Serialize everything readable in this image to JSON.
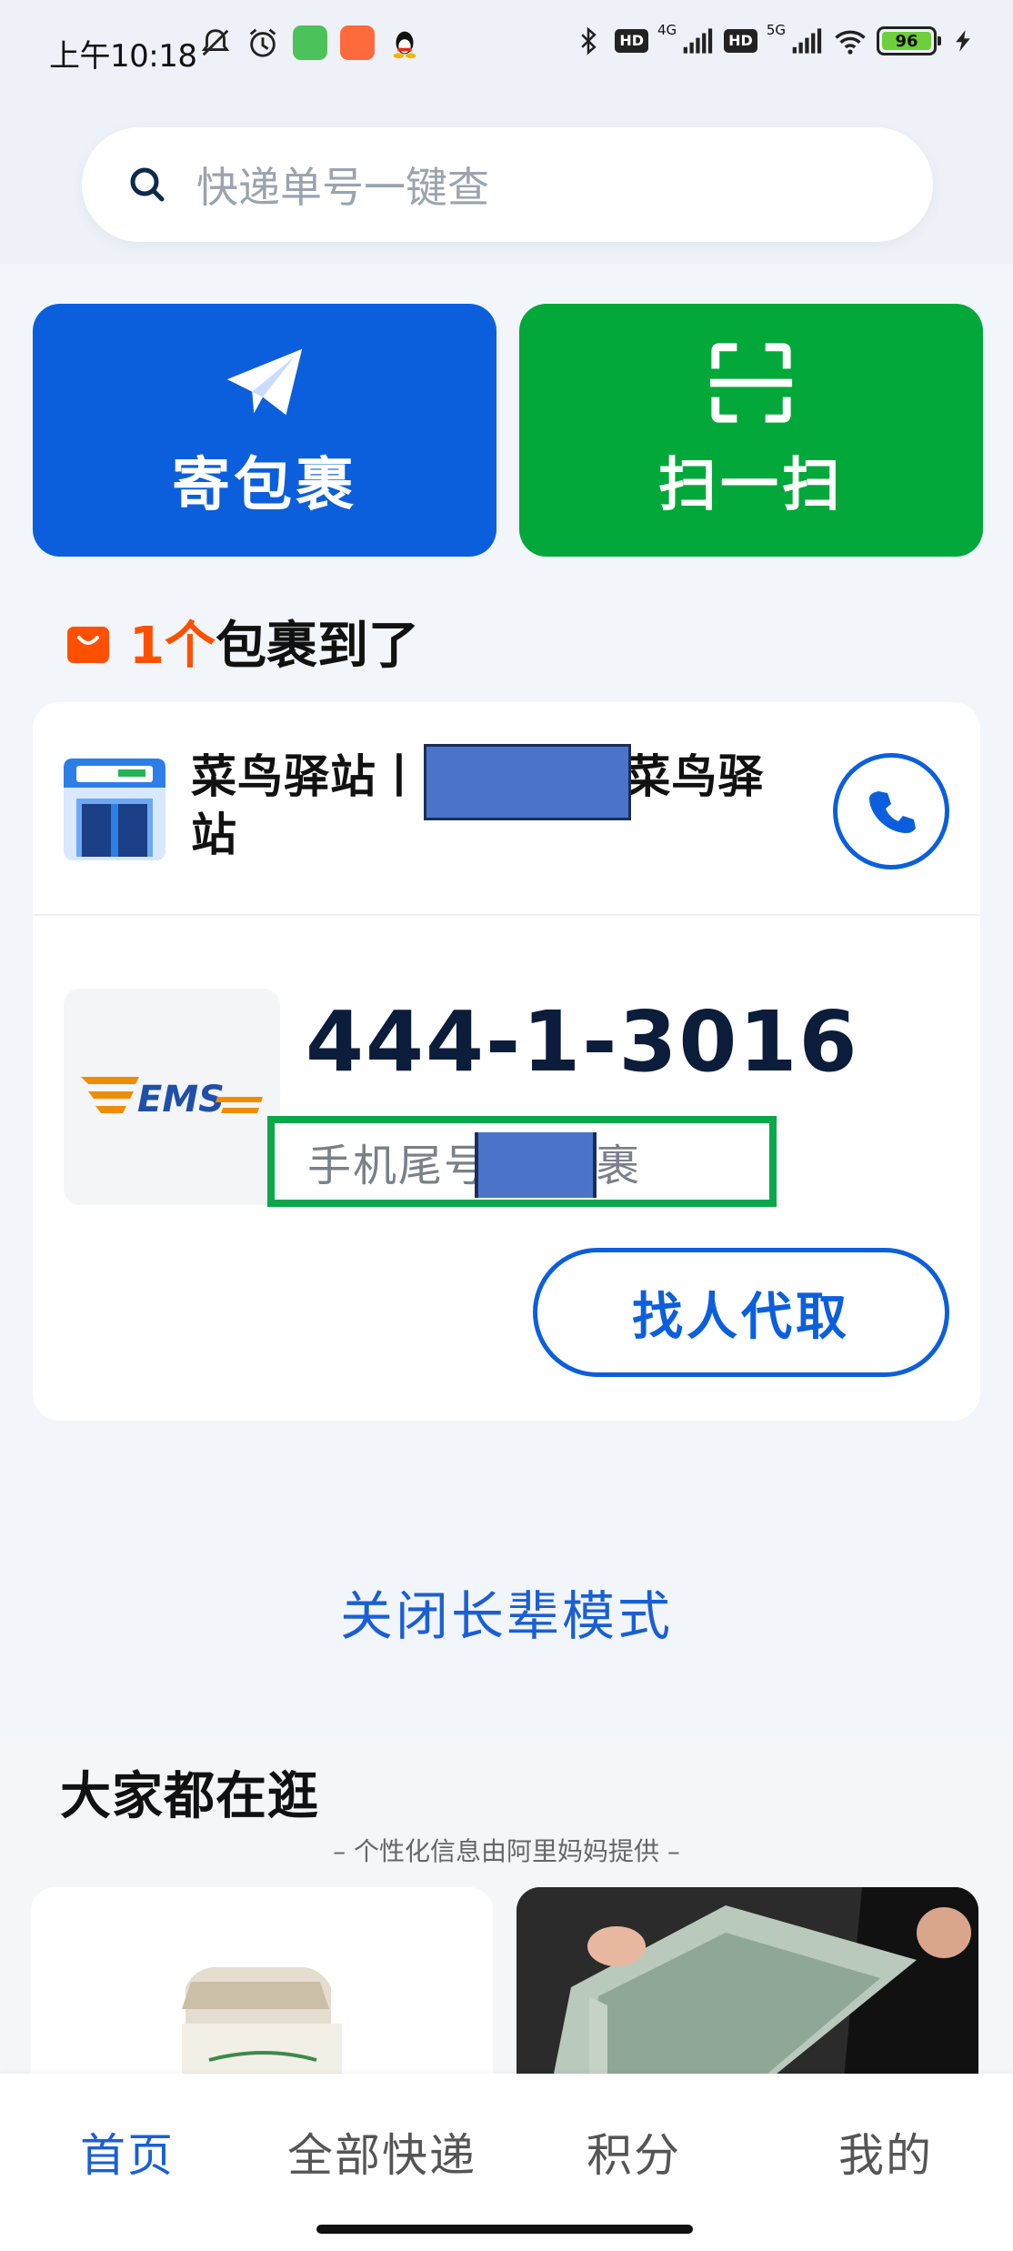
{
  "status_bar": {
    "time": "上午10:18",
    "net1": "4G",
    "net2": "5G",
    "hd": "HD",
    "battery": "96"
  },
  "search": {
    "placeholder": "快递单号一键查"
  },
  "actions": {
    "send_label": "寄包裹",
    "scan_label": "扫一扫"
  },
  "arrived": {
    "count": "1个",
    "text": "包裹到了"
  },
  "parcel": {
    "station_name": "菜鸟驿站丨          大学校内菜鸟驿站",
    "carrier_logo_text": "EMS",
    "pickup_code": "444-1-3016",
    "phone_tail_label": "手机尾号      的包裹",
    "proxy_button": "找人代取"
  },
  "elder_mode": {
    "close_label": "关闭长辈模式"
  },
  "recommend": {
    "title": "大家都在逛",
    "subtitle": "– 个性化信息由阿里妈妈提供 –"
  },
  "tabs": [
    {
      "label": "首页",
      "active": true
    },
    {
      "label": "全部快递",
      "active": false
    },
    {
      "label": "积分",
      "active": false
    },
    {
      "label": "我的",
      "active": false
    }
  ],
  "colors": {
    "brand_blue": "#0c5fdc",
    "brand_green": "#02a83a",
    "accent_orange": "#ff5000"
  }
}
